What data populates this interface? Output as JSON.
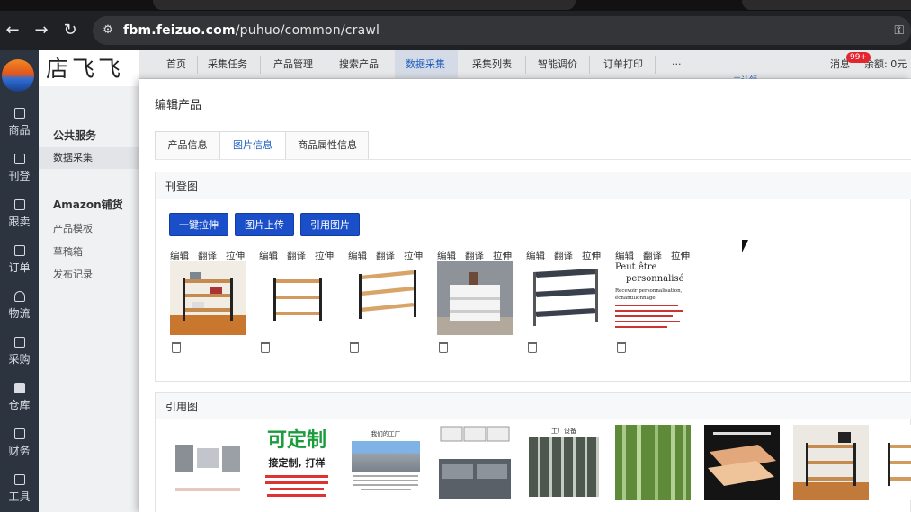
{
  "browser": {
    "url_host": "fbm.feizuo.com",
    "url_path": "/puhuo/common/crawl",
    "back_icon": "arrow-left-icon",
    "forward_icon": "arrow-right-icon",
    "reload_icon": "reload-icon",
    "site_icon": "tune-icon",
    "key_icon": "key-icon"
  },
  "brand": {
    "name": "店飞飞"
  },
  "sidebar": {
    "items": [
      {
        "label": "商品",
        "icon": "box-icon"
      },
      {
        "label": "刊登",
        "icon": "publish-icon"
      },
      {
        "label": "跟卖",
        "icon": "follow-icon"
      },
      {
        "label": "订单",
        "icon": "order-icon"
      },
      {
        "label": "物流",
        "icon": "home-icon"
      },
      {
        "label": "采购",
        "icon": "cart-icon"
      },
      {
        "label": "仓库",
        "icon": "warehouse-icon"
      },
      {
        "label": "财务",
        "icon": "finance-icon"
      },
      {
        "label": "工具",
        "icon": "tools-icon"
      }
    ]
  },
  "topnav": {
    "tabs": [
      "首页",
      "采集任务",
      "产品管理",
      "搜索产品",
      "数据采集",
      "采集列表",
      "智能调价",
      "订单打印",
      "···"
    ],
    "close_mark": "×",
    "messages": "消息",
    "badge": "99+",
    "balance": "余额: 0元",
    "peek": "未认领"
  },
  "subside": {
    "groups": [
      {
        "title": "公共服务",
        "links": [
          "数据采集"
        ]
      },
      {
        "title": "Amazon铺货",
        "links": [
          "产品模板",
          "草稿箱",
          "发布记录"
        ]
      }
    ]
  },
  "main": {
    "title": "编辑产品",
    "tabs": [
      "产品信息",
      "图片信息",
      "商品属性信息"
    ],
    "active_tab": "图片信息",
    "listing_section": {
      "title": "刊登图",
      "buttons": [
        "一键拉伸",
        "图片上传",
        "引用图片"
      ],
      "actions": [
        "编辑",
        "翻译",
        "拉伸"
      ],
      "image_texts": {
        "title_line1": "Peut être",
        "title_line2": "personnalisé",
        "line3": "Recevoir personnalisation,",
        "line4": "échantillonnage"
      }
    },
    "reference_section": {
      "title": "引用图",
      "image_texts": {
        "customizable": "可定制",
        "customizable_sub": "接定制, 打样",
        "our_factory": "我们的工厂",
        "factory_equipment": "工厂设备"
      }
    }
  },
  "colors": {
    "primary": "#1a4fc9",
    "active_text": "#1f5fbf",
    "sidebar_bg": "#2c3440",
    "badge": "#e4252f"
  }
}
